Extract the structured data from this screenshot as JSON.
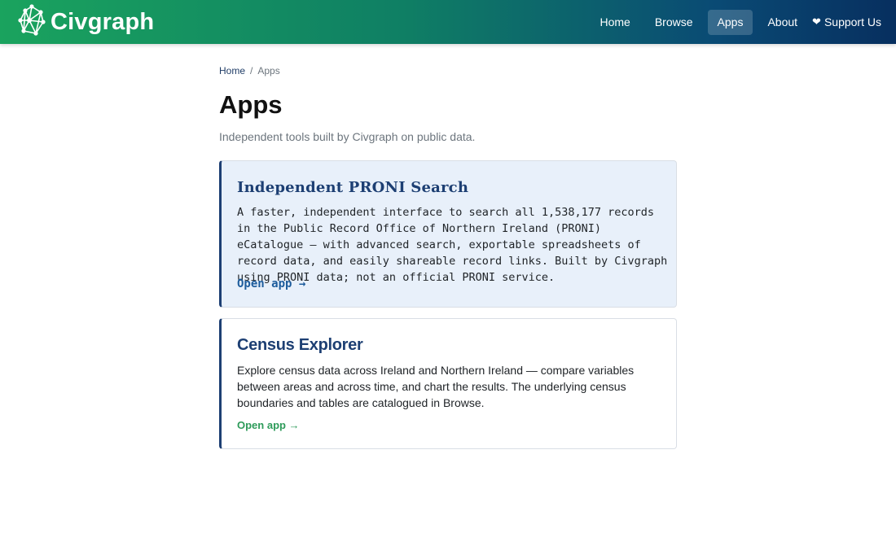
{
  "brand": {
    "name": "Civgraph",
    "logo_icon": "network-graph-icon"
  },
  "nav": {
    "items": [
      {
        "label": "Home",
        "active": false
      },
      {
        "label": "Browse",
        "active": false
      },
      {
        "label": "Apps",
        "active": true
      },
      {
        "label": "About",
        "active": false
      }
    ],
    "support": {
      "icon": "heart-icon",
      "glyph": "❤",
      "label": "Support Us"
    }
  },
  "breadcrumb": {
    "home": "Home",
    "separator": "/",
    "current": "Apps"
  },
  "page": {
    "title": "Apps",
    "subtitle": "Independent tools built by Civgraph on public data."
  },
  "apps": [
    {
      "title": "Independent PRONI Search",
      "description": "A faster, independent interface to search all 1,538,177 records in the Public Record Office of Northern Ireland (PRONI) eCatalogue — with advanced search, exportable spreadsheets of record data, and easily shareable record links. Built by Civgraph using PRONI data; not an official PRONI service.",
      "link": "Open app →"
    },
    {
      "title": "Census Explorer",
      "description": "Explore census data across Ireland and Northern Ireland — compare variables between areas and across time, and chart the results. The underlying census boundaries and tables are catalogued in Browse.",
      "link": "Open app →"
    }
  ],
  "colors": {
    "nav_gradient_start": "#1aa35e",
    "nav_gradient_end": "#072f5f",
    "accent_navy": "#1d3f73",
    "link_blue": "#1d5c9c",
    "link_green": "#2e9b5a",
    "card_highlight_bg": "#e8f0fa"
  }
}
